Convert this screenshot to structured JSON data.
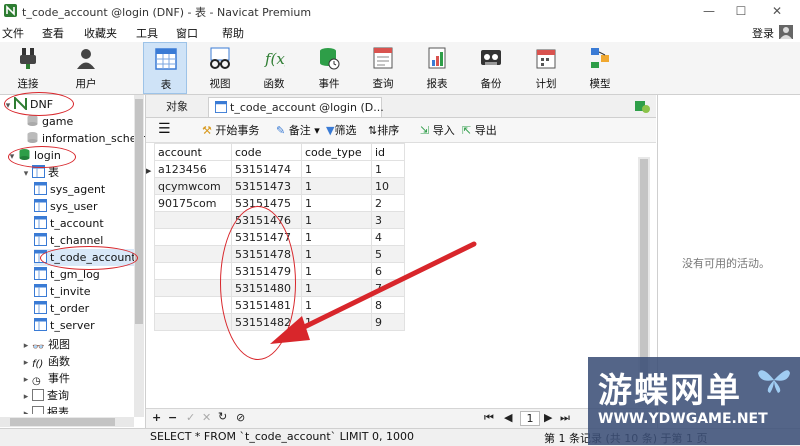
{
  "window": {
    "title": "t_code_account @login (DNF) - 表 - Navicat Premium",
    "login_label": "登录",
    "minimize": "—",
    "maximize": "☐",
    "close": "✕"
  },
  "menu": [
    "文件",
    "查看",
    "收藏夹",
    "工具",
    "窗口",
    "帮助"
  ],
  "toolbar": [
    {
      "label": "连接",
      "icon": "connect-icon"
    },
    {
      "label": "用户",
      "icon": "user-icon"
    },
    {
      "label": "表",
      "icon": "table-icon",
      "active": true
    },
    {
      "label": "视图",
      "icon": "view-icon"
    },
    {
      "label": "函数",
      "icon": "function-icon"
    },
    {
      "label": "事件",
      "icon": "event-icon"
    },
    {
      "label": "查询",
      "icon": "query-icon"
    },
    {
      "label": "报表",
      "icon": "report-icon"
    },
    {
      "label": "备份",
      "icon": "backup-icon"
    },
    {
      "label": "计划",
      "icon": "schedule-icon"
    },
    {
      "label": "模型",
      "icon": "model-icon"
    }
  ],
  "nav": {
    "connection": "DNF",
    "databases": [
      "game",
      "information_schema"
    ],
    "current_db": "login",
    "tables_group": "表",
    "tables": [
      "sys_agent",
      "sys_user",
      "t_account",
      "t_channel",
      "t_code_account",
      "t_gm_log",
      "t_invite",
      "t_order",
      "t_server"
    ],
    "selected_table": "t_code_account",
    "other_groups": [
      "视图",
      "函数",
      "事件",
      "查询",
      "报表"
    ]
  },
  "tabs": {
    "objects": "对象",
    "current": "t_code_account @login (D..."
  },
  "grid_toolbar": {
    "begin_transaction": "开始事务",
    "memo": "备注",
    "filter": "筛选",
    "sort": "排序",
    "import": "导入",
    "export": "导出"
  },
  "grid": {
    "columns": [
      "account",
      "code",
      "code_type",
      "id"
    ],
    "rows": [
      [
        "a123456",
        "53151474",
        "1",
        "1"
      ],
      [
        "qcymwcom",
        "53151473",
        "1",
        "10"
      ],
      [
        "90175com",
        "53151475",
        "1",
        "2"
      ],
      [
        "",
        "53151476",
        "1",
        "3"
      ],
      [
        "",
        "53151477",
        "1",
        "4"
      ],
      [
        "",
        "53151478",
        "1",
        "5"
      ],
      [
        "",
        "53151479",
        "1",
        "6"
      ],
      [
        "",
        "53151480",
        "1",
        "7"
      ],
      [
        "",
        "53151481",
        "1",
        "8"
      ],
      [
        "",
        "53151482",
        "1",
        "9"
      ]
    ],
    "current_row_marker": "▶"
  },
  "info_pane": {
    "message": "没有可用的活动。"
  },
  "grid_nav": {
    "page": "1"
  },
  "status": {
    "sql": "SELECT * FROM `t_code_account` LIMIT 0, 1000",
    "records": "第 1 条记录 (共 10 条) 于第 1 页"
  },
  "watermark": {
    "title": "游蝶网单",
    "url": "WWW.YDWGAME.NET"
  },
  "colors": {
    "annotation": "#d8262b",
    "active_tool": "#cfe3f7"
  }
}
